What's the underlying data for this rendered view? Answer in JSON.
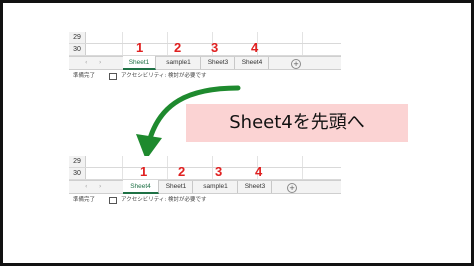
{
  "top_screen": {
    "row_numbers": [
      "29",
      "30"
    ],
    "tabs": [
      "Sheet1",
      "sample1",
      "Sheet3",
      "Sheet4"
    ],
    "active_tab": "Sheet1",
    "nav_prev": "‹",
    "nav_next": "›",
    "add_sheet": "+",
    "status_ready": "準備完了",
    "status_accessibility": "アクセシビリティ: 検討が必要です",
    "markers": [
      "1",
      "2",
      "3",
      "4"
    ]
  },
  "bottom_screen": {
    "row_numbers": [
      "29",
      "30"
    ],
    "tabs": [
      "Sheet4",
      "Sheet1",
      "sample1",
      "Sheet3"
    ],
    "active_tab": "Sheet4",
    "nav_prev": "‹",
    "nav_next": "›",
    "add_sheet": "+",
    "status_ready": "準備完了",
    "status_accessibility": "アクセシビリティ: 検討が必要です",
    "markers": [
      "1",
      "2",
      "3",
      "4"
    ]
  },
  "callout": {
    "text": "Sheet4を先頭へ"
  },
  "colors": {
    "marker": "#e02020",
    "arrow": "#1e8a2e",
    "callout_bg": "#fbd3d3",
    "active_tab": "#1e7145"
  }
}
